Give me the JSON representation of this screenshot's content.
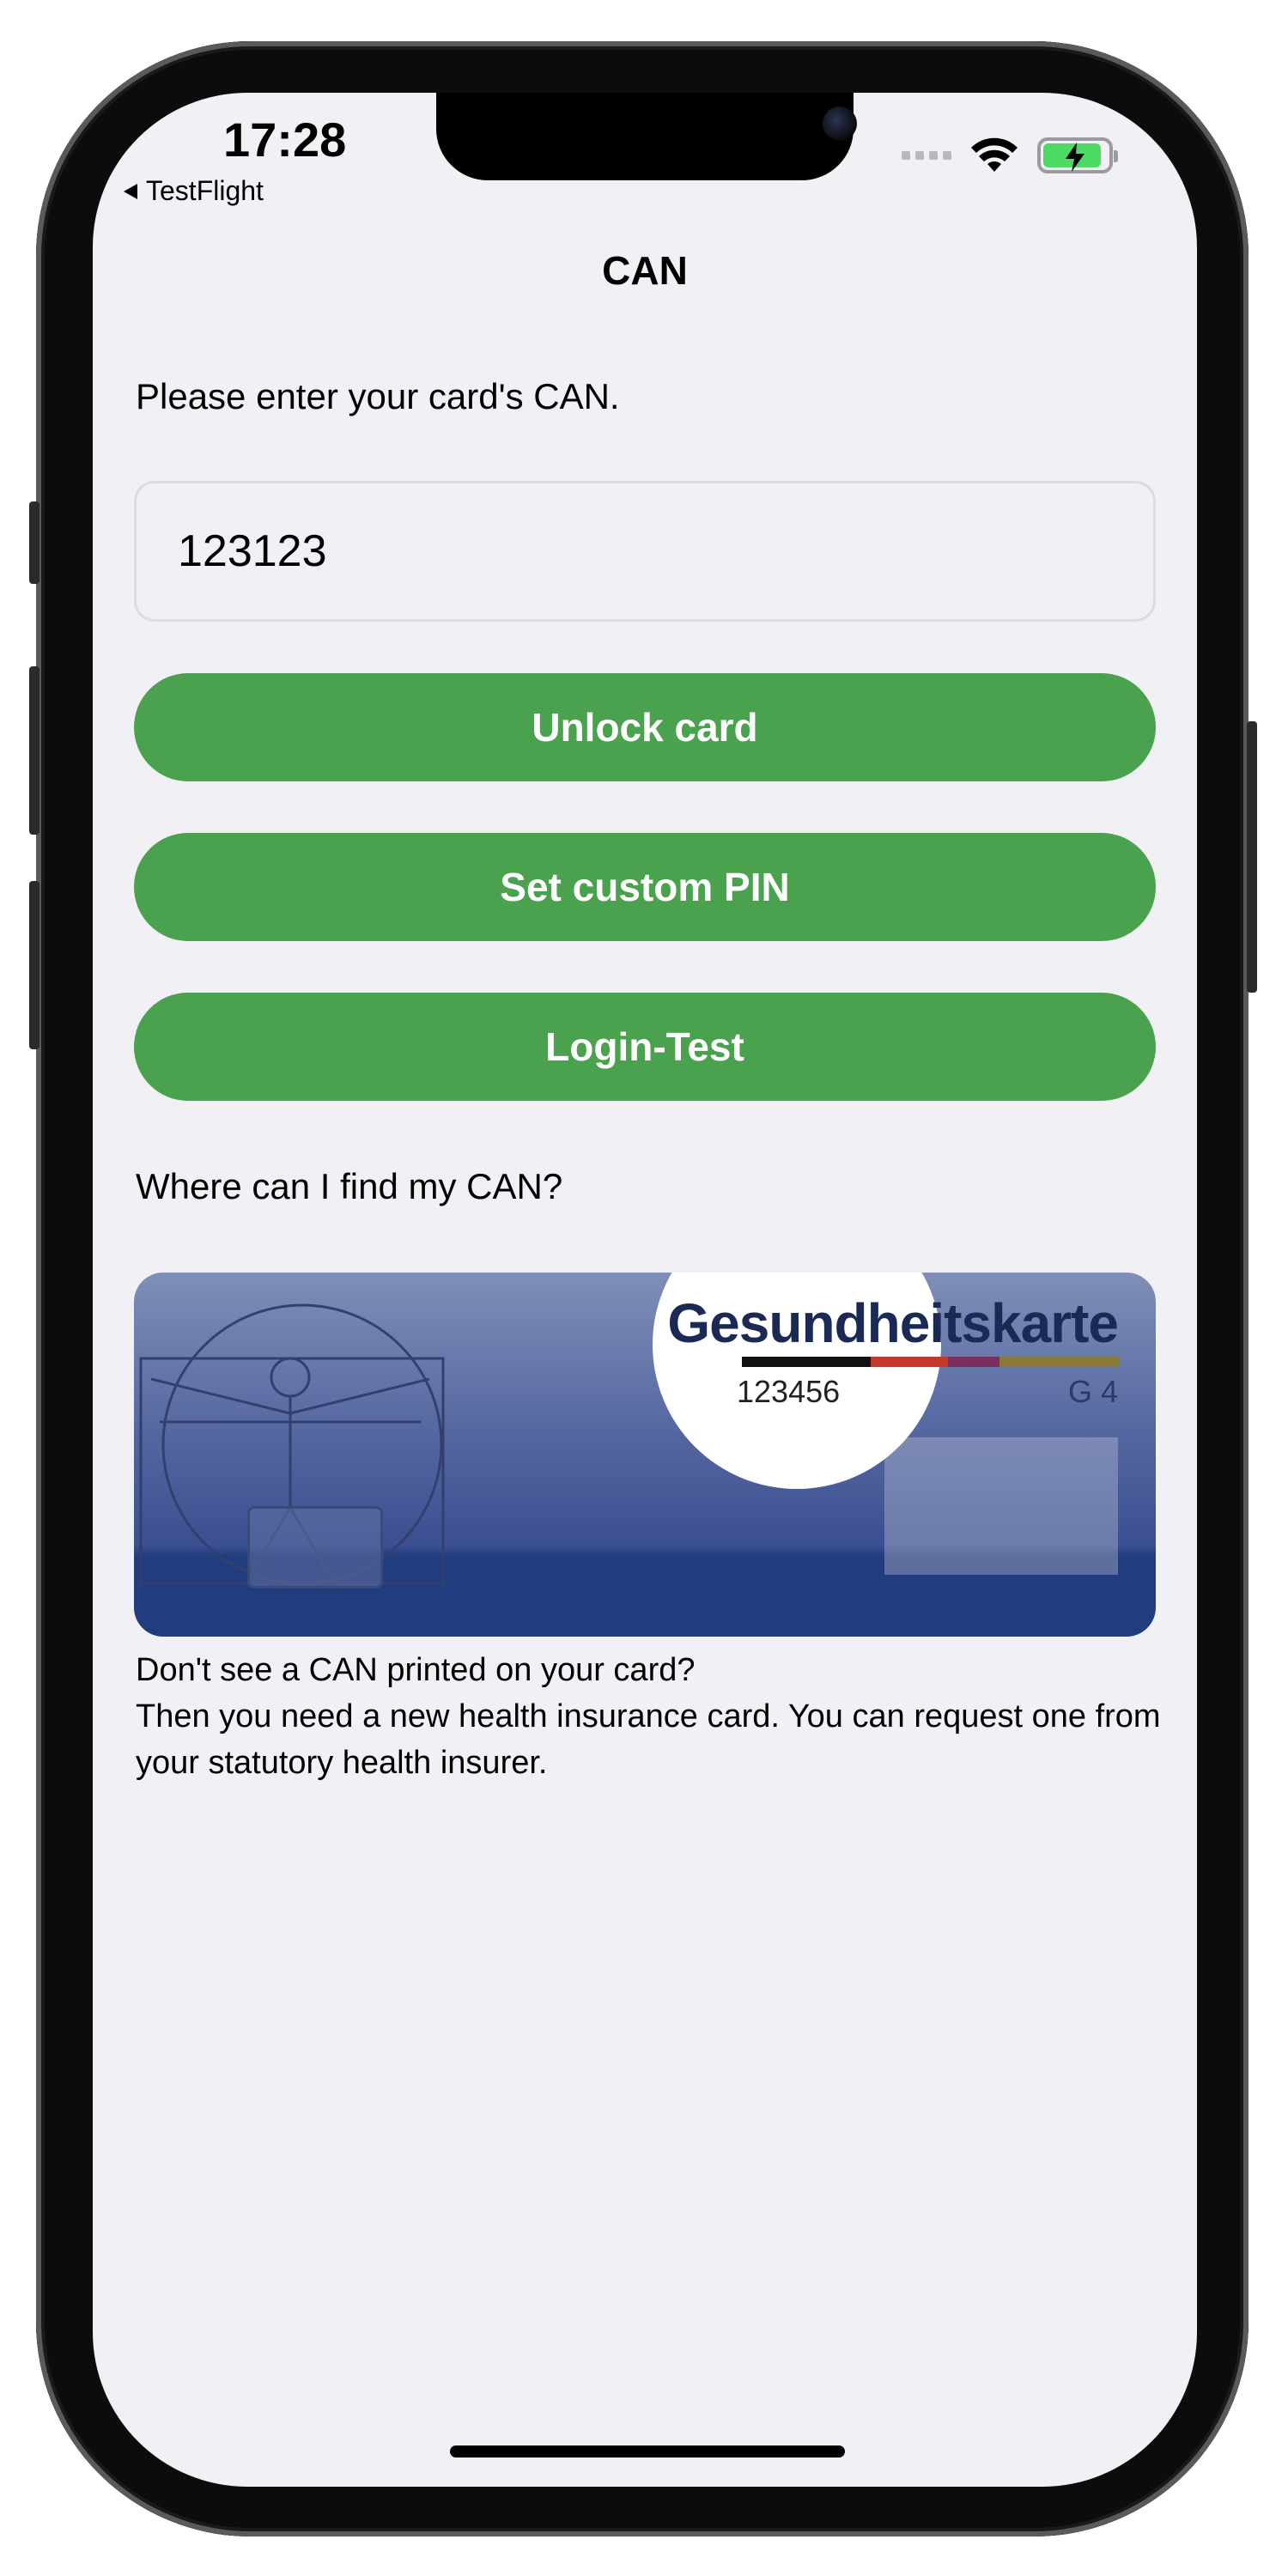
{
  "status_bar": {
    "time": "17:28",
    "back_label": "TestFlight",
    "wifi_icon": "wifi-icon",
    "battery_icon": "battery-charging-icon",
    "battery_level": 0.9,
    "colors": {
      "battery": "#4cd964"
    }
  },
  "nav": {
    "title": "CAN"
  },
  "form": {
    "prompt": "Please enter your card's CAN.",
    "can_value": "123123"
  },
  "buttons": {
    "unlock": "Unlock card",
    "set_pin": "Set custom PIN",
    "login_test": "Login-Test",
    "color": "#4aa14e"
  },
  "help": {
    "heading": "Where can I find my CAN?",
    "card": {
      "title": "Gesundheitskarte",
      "can_number": "123456",
      "generation": "G 4"
    },
    "info_line1": "Don't see a CAN printed on your card?",
    "info_line2": "Then you need a new health insurance card. You can request one from your statutory health insurer."
  }
}
